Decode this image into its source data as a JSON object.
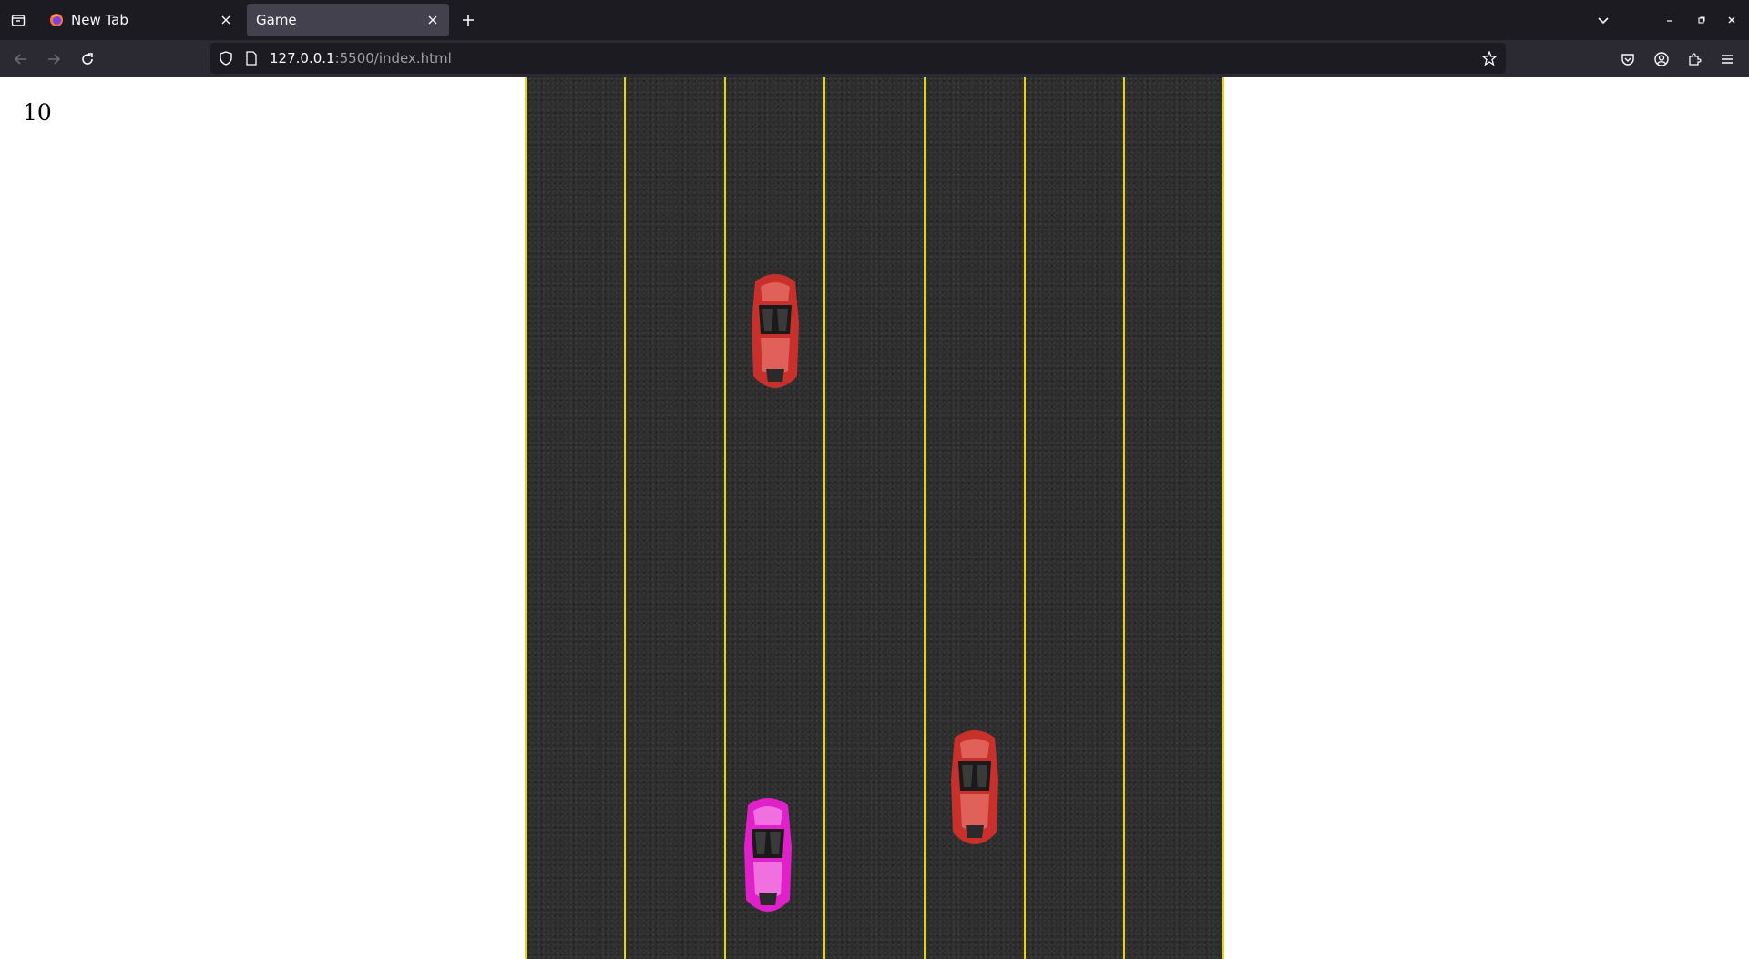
{
  "browser": {
    "tabs": [
      {
        "title": "New Tab",
        "active": false,
        "favicon": "firefox-icon"
      },
      {
        "title": "Game",
        "active": true
      }
    ],
    "url_host": "127.0.0.1",
    "url_rest": ":5500/index.html"
  },
  "game": {
    "score": "10",
    "road": {
      "lanes": 7,
      "lane_line_color": "#e8d400",
      "asphalt_color": "#2d2d2d"
    },
    "player_car": {
      "color": "#e020c8",
      "lane": 2
    },
    "enemy_cars": [
      {
        "color": "#c8302c",
        "lane": 2
      },
      {
        "color": "#c8302c",
        "lane": 4
      }
    ]
  }
}
